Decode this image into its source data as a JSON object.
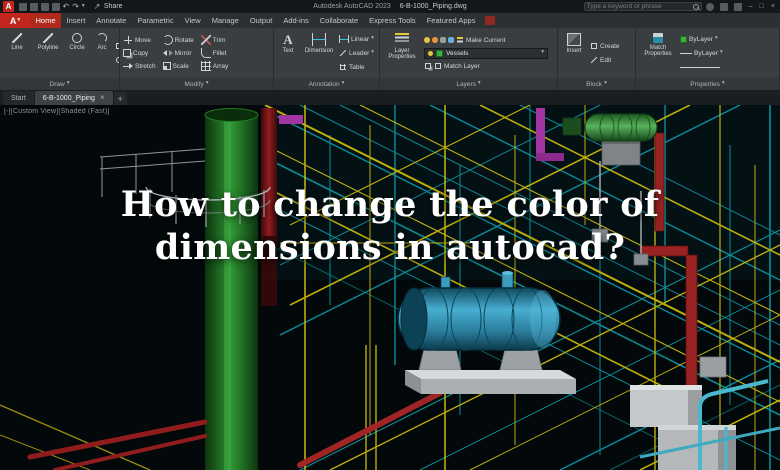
{
  "titlebar": {
    "logo_letter": "A",
    "share_label": "Share",
    "app_title": "Autodesk AutoCAD 2023",
    "doc_title": "6-B-1000_Piping.dwg",
    "search_placeholder": "Type a keyword or phrase"
  },
  "icons": {
    "caret": "▾",
    "close": "×",
    "plus": "+",
    "minimize": "–",
    "maximize": "□",
    "undo": "↶",
    "redo": "↷",
    "share": "↗",
    "text_a": "A"
  },
  "ribbon": {
    "tabs": [
      "Home",
      "Insert",
      "Annotate",
      "Parametric",
      "View",
      "Manage",
      "Output",
      "Add-ins",
      "Collaborate",
      "Express Tools",
      "Featured Apps"
    ],
    "active_tab": "Home",
    "panels": {
      "draw": {
        "label": "Draw",
        "line": "Line",
        "polyline": "Polyline",
        "circle": "Circle",
        "arc": "Arc"
      },
      "modify": {
        "label": "Modify",
        "move": "Move",
        "rotate": "Rotate",
        "trim": "Trim",
        "copy": "Copy",
        "mirror": "Mirror",
        "fillet": "Fillet",
        "stretch": "Stretch",
        "scale": "Scale",
        "array": "Array"
      },
      "annotation": {
        "label": "Annotation",
        "text": "Text",
        "dimension": "Dimension",
        "linear": "Linear",
        "leader": "Leader",
        "table": "Table"
      },
      "layers": {
        "label": "Layers",
        "layer_properties": "Layer Properties",
        "make_current": "Make Current",
        "current_layer": "Vessels",
        "match_layer": "Match Layer"
      },
      "block": {
        "label": "Block",
        "insert": "Insert",
        "create": "Create",
        "edit": "Edit"
      },
      "properties": {
        "label": "Properties",
        "match_properties": "Match Properties",
        "bylayer_color": "ByLayer",
        "bylayer_line": "ByLayer"
      }
    }
  },
  "file_tabs": {
    "start": "Start",
    "drawing": "6-B-1000_Piping"
  },
  "viewport": {
    "controls_label": "[-][Custom View][Shaded (Fast)]"
  },
  "overlay": {
    "line1": "How to change the color of",
    "line2": "dimensions in autocad?"
  },
  "colors": {
    "accent_red": "#c2261f",
    "vessels_layer_green": "#3fae3f",
    "pipe_green": "#2f9633",
    "pipe_yellow": "#c9b70e",
    "structure_teal": "#0d99a6",
    "pipe_red": "#a02525",
    "pipe_maroon": "#8f1d1d",
    "vessel_cyan": "#48aed1",
    "vessel_green": "#58b25c",
    "overlay_text": "#ffffff"
  }
}
